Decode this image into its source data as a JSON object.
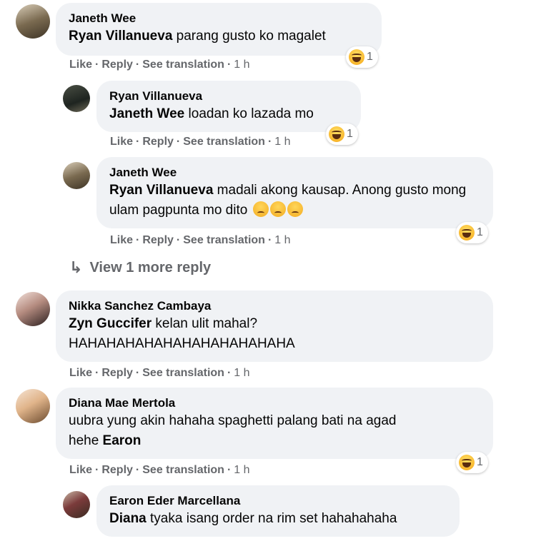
{
  "actions": {
    "like": "Like",
    "reply": "Reply",
    "translate": "See translation",
    "time": "1 h"
  },
  "view_more": "View 1 more reply",
  "comments": [
    {
      "author": "Janeth Wee",
      "mention": "Ryan Villanueva",
      "text": " parang gusto ko magalet",
      "reaction_icon": "haha-icon",
      "reaction_count": "1"
    },
    {
      "author": "Ryan Villanueva",
      "mention": "Janeth Wee",
      "text": " loadan ko lazada mo",
      "reaction_icon": "haha-icon",
      "reaction_count": "1"
    },
    {
      "author": "Janeth Wee",
      "mention": "Ryan Villanueva",
      "text": " madali akong kausap. Anong gusto mong ulam pagpunta mo dito",
      "emoji": "pensive-face-icon",
      "reaction_icon": "haha-icon",
      "reaction_count": "1"
    },
    {
      "author": "Nikka Sanchez Cambaya",
      "mention": "Zyn Guccifer",
      "text": " kelan ulit mahal?",
      "text2": "HAHAHAHAHAHAHAHAHAHAHAHA"
    },
    {
      "author": "Diana Mae Mertola",
      "text": "uubra yung akin hahaha spaghetti palang bati na agad",
      "text2_prefix": "hehe ",
      "mention": "Earon",
      "reaction_icon": "haha-icon",
      "reaction_count": "1"
    },
    {
      "author": "Earon Eder Marcellana",
      "mention": "Diana",
      "text": " tyaka isang order na rim set hahahahaha"
    }
  ]
}
